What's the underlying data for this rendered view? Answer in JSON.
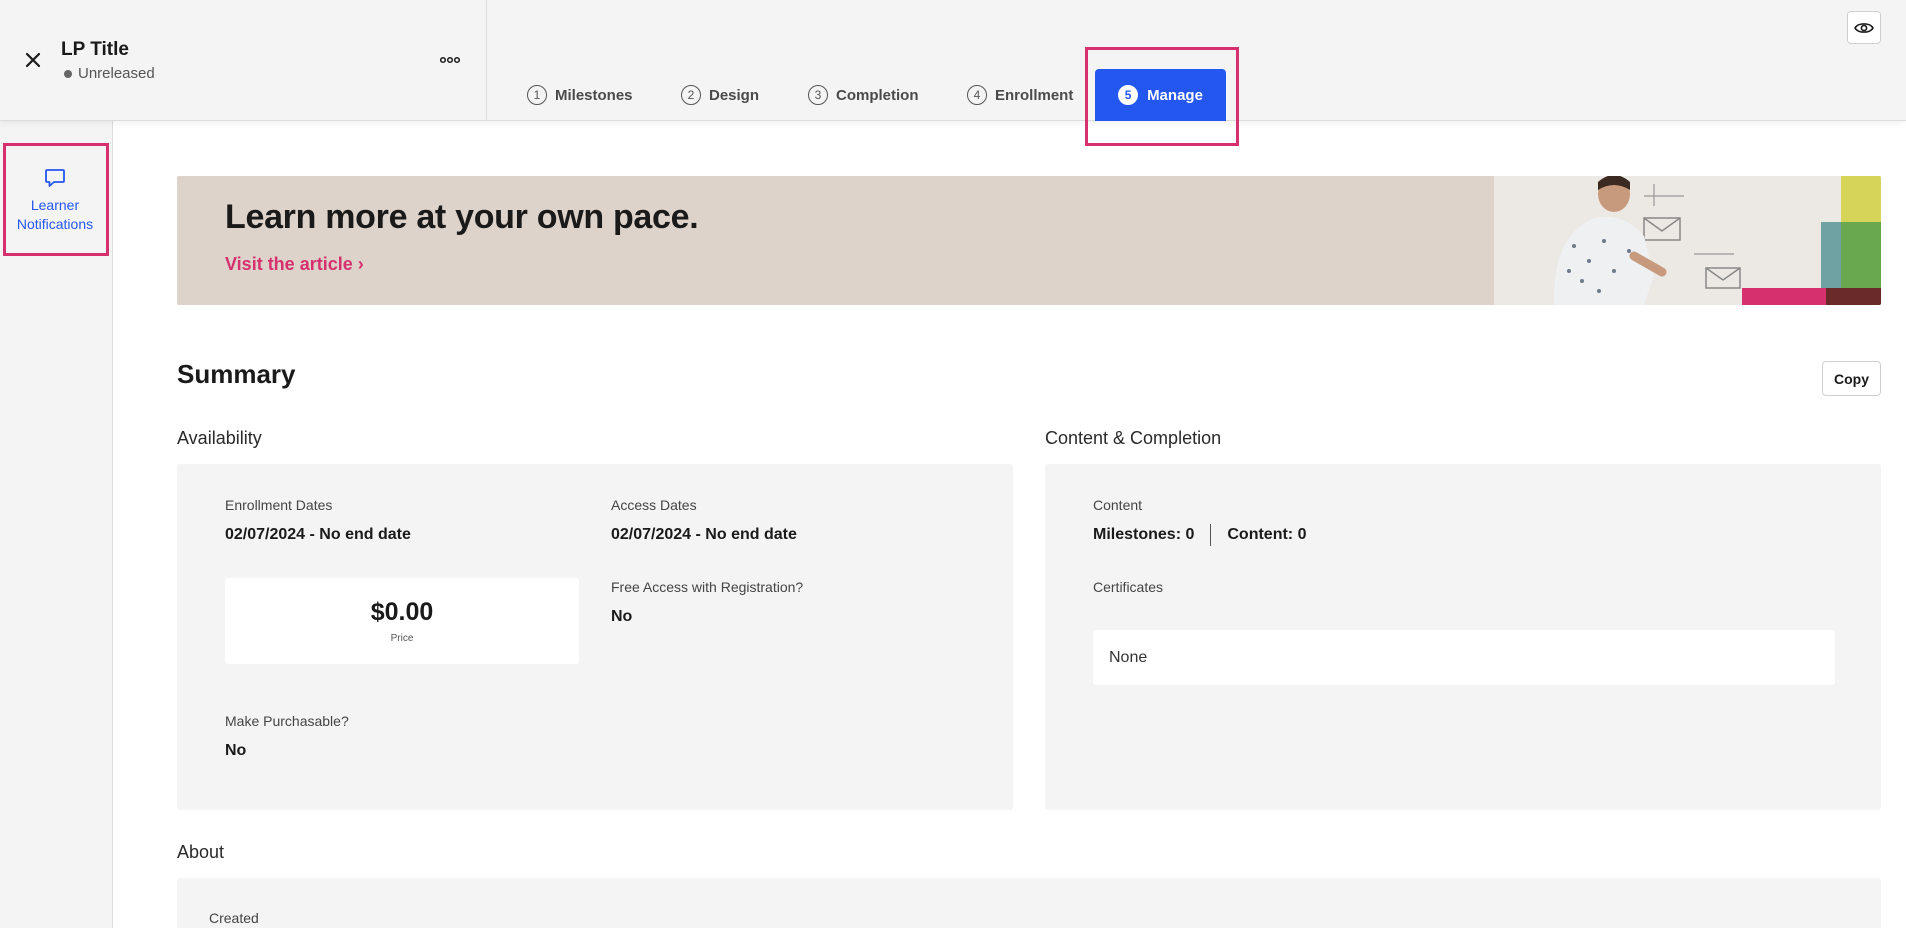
{
  "header": {
    "title": "LP Title",
    "status": "Unreleased",
    "tabs": [
      {
        "num": "1",
        "label": "Milestones"
      },
      {
        "num": "2",
        "label": "Design"
      },
      {
        "num": "3",
        "label": "Completion"
      },
      {
        "num": "4",
        "label": "Enrollment"
      },
      {
        "num": "5",
        "label": "Manage"
      }
    ],
    "active_tab": "Manage"
  },
  "sidebar": {
    "items": [
      {
        "label_line1": "Learner",
        "label_line2": "Notifications",
        "icon": "chat-bubble-icon"
      }
    ]
  },
  "banner": {
    "heading": "Learn more at your own pace.",
    "link_text": "Visit the article ›"
  },
  "summary": {
    "title": "Summary",
    "copy_label": "Copy",
    "availability": {
      "section_title": "Availability",
      "enrollment_dates_label": "Enrollment Dates",
      "enrollment_dates_value": "02/07/2024 - No end date",
      "access_dates_label": "Access Dates",
      "access_dates_value": "02/07/2024 - No end date",
      "price_value": "$0.00",
      "price_label": "Price",
      "free_access_label": "Free Access with Registration?",
      "free_access_value": "No",
      "purchasable_label": "Make Purchasable?",
      "purchasable_value": "No"
    },
    "content_completion": {
      "section_title": "Content & Completion",
      "content_label": "Content",
      "milestones_value": "Milestones: 0",
      "content_value": "Content: 0",
      "certificates_label": "Certificates",
      "certificates_value": "None"
    }
  },
  "about": {
    "section_title": "About",
    "created_label": "Created"
  },
  "colors": {
    "accent_blue": "#2456f0",
    "highlight_pink": "#d6306e",
    "panel_gray": "#f4f4f4",
    "banner_bg": "#ddd3cb"
  }
}
